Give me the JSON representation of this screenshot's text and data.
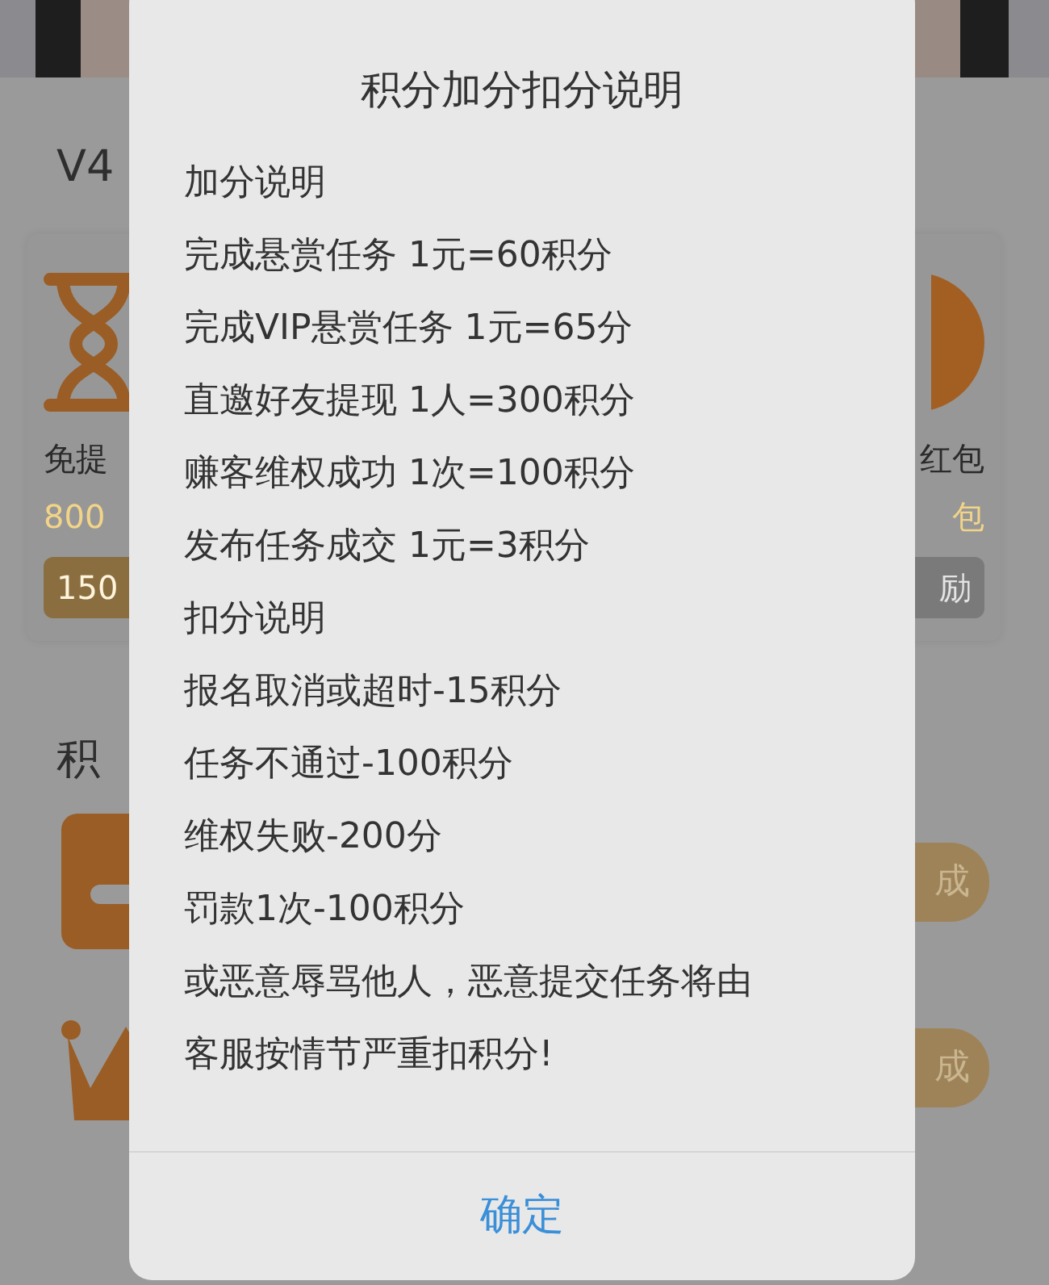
{
  "page": {
    "section_title": "V4",
    "cards": [
      {
        "title": "免提",
        "subtitle": "800",
        "pill": "150"
      },
      {
        "title": "红包",
        "subtitle": "包",
        "pill": "励"
      }
    ],
    "points_title": "积",
    "tasks": [
      {
        "button": "成"
      },
      {
        "button": "成"
      }
    ]
  },
  "dialog": {
    "title": "积分加分扣分说明",
    "lines": [
      "加分说明",
      "完成悬赏任务 1元=60积分",
      "完成VIP悬赏任务 1元=65分",
      "直邀好友提现 1人=300积分",
      "赚客维权成功 1次=100积分",
      "发布任务成交 1元=3积分",
      "扣分说明",
      "报名取消或超时-15积分",
      "任务不通过-100积分",
      "维权失败-200分",
      "罚款1次-100积分",
      "或恶意辱骂他人，恶意提交任务将由客服按情节严重扣积分!"
    ],
    "button": "确定"
  }
}
